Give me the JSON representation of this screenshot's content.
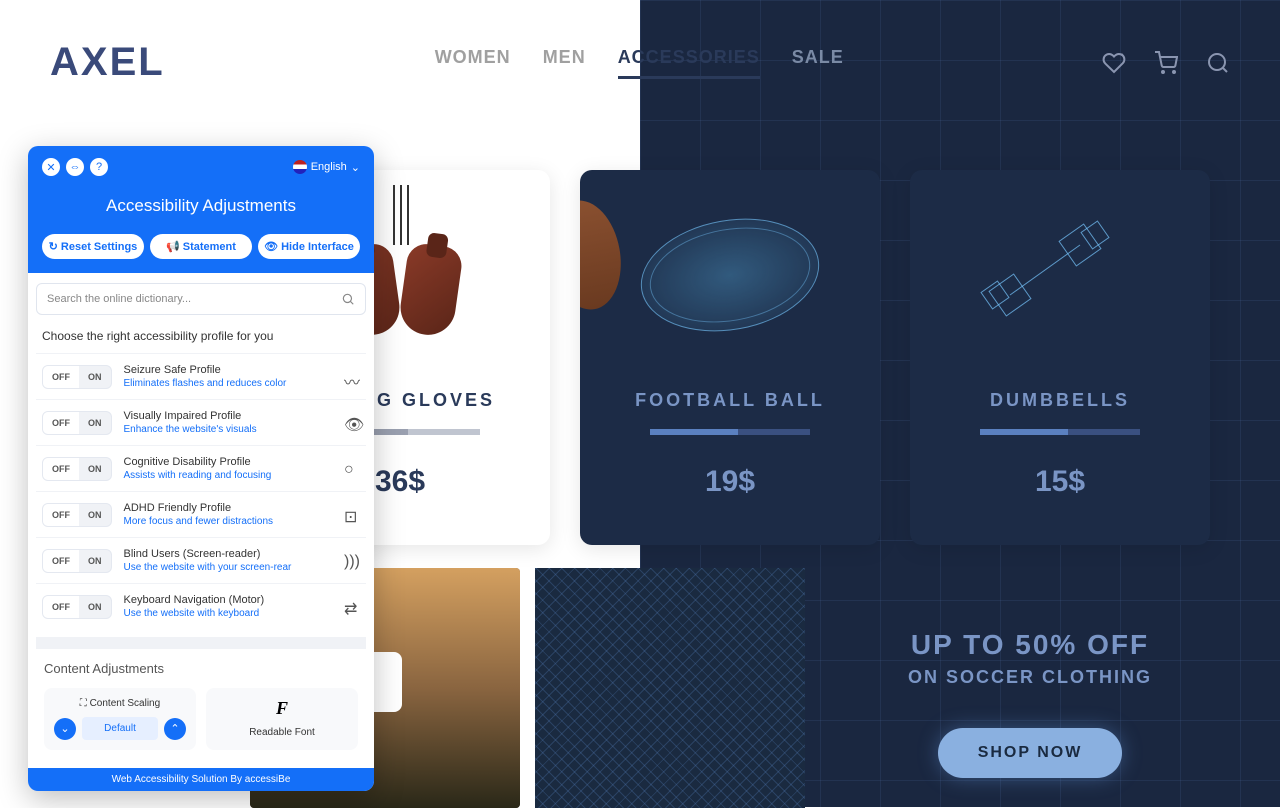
{
  "header": {
    "logo": "AXEL",
    "nav": [
      "WOMEN",
      "MEN",
      "ACCESSORIES",
      "SALE"
    ],
    "active_nav_index": 2
  },
  "products": [
    {
      "name": "BOXING GLOVES",
      "price": "36$"
    },
    {
      "name": "FOOTBALL BALL",
      "price": "19$"
    },
    {
      "name": "DUMBBELLS",
      "price": "15$"
    }
  ],
  "promo": {
    "title": "UP TO 50% OFF",
    "subtitle": "ON SOCCER CLOTHING",
    "cta": "SHOP NOW"
  },
  "a11y": {
    "language": "English",
    "title": "Accessibility Adjustments",
    "buttons": {
      "reset": "Reset Settings",
      "statement": "Statement",
      "hide": "Hide Interface"
    },
    "search_placeholder": "Search the online dictionary...",
    "choose_profile": "Choose the right accessibility profile for you",
    "toggle_off": "OFF",
    "toggle_on": "ON",
    "profiles": [
      {
        "name": "Seizure Safe Profile",
        "desc": "Eliminates flashes and reduces color"
      },
      {
        "name": "Visually Impaired Profile",
        "desc": "Enhance the website's visuals"
      },
      {
        "name": "Cognitive Disability Profile",
        "desc": "Assists with reading and focusing"
      },
      {
        "name": "ADHD Friendly Profile",
        "desc": "More focus and fewer distractions"
      },
      {
        "name": "Blind Users (Screen-reader)",
        "desc": "Use the website with your screen-rear"
      },
      {
        "name": "Keyboard Navigation (Motor)",
        "desc": "Use the website with keyboard"
      }
    ],
    "content_adjustments": "Content Adjustments",
    "scaling_label": "Content Scaling",
    "scaling_value": "Default",
    "readable_font": "Readable Font",
    "footer": "Web Accessibility Solution By accessiBe"
  }
}
